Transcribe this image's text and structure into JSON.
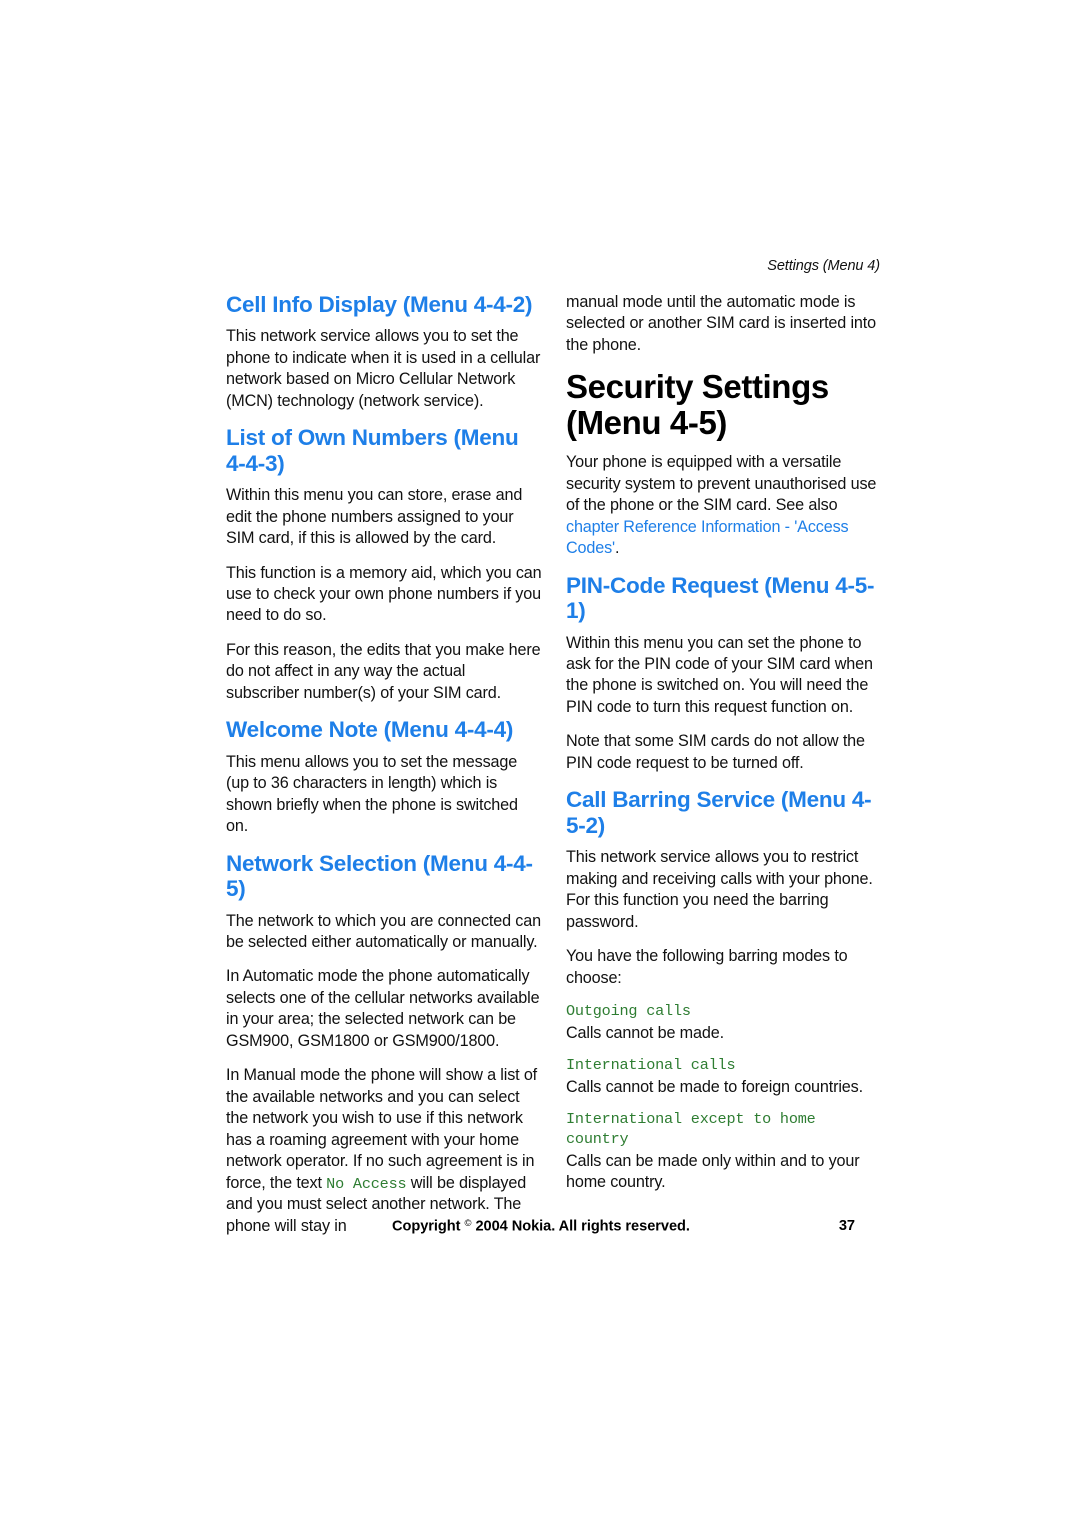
{
  "document": {
    "running_header": "Settings (Menu 4)",
    "footer": {
      "copyright_prefix": "Copyright",
      "copyright_symbol": "©",
      "copyright_suffix": "2004 Nokia. All rights reserved.",
      "page_number": "37"
    },
    "colors": {
      "heading_blue": "#1E7FE8",
      "xref_blue": "#1E7FE8",
      "ui_term_green": "#2E7D32",
      "body_black": "#111111",
      "page_background": "#FFFFFF"
    }
  },
  "left_column": {
    "cell_info_display": {
      "heading": "Cell Info Display (Menu 4-4-2)",
      "paragraph_1": "This network service allows you to set the phone to indicate when it is used in a cellular network based on Micro Cellular Network (MCN) technology (network service)."
    },
    "list_of_own_numbers": {
      "heading": "List of Own Numbers (Menu 4-4-3)",
      "paragraph_1": "Within this menu you can store, erase and edit the phone numbers assigned to your SIM card, if this is allowed by the card.",
      "paragraph_2": "This function is a memory aid, which you can use to check your own phone numbers if you need to do so.",
      "paragraph_3": "For this reason, the edits that you make here do not affect in any way the actual subscriber number(s) of your SIM card."
    },
    "welcome_note": {
      "heading": "Welcome Note (Menu 4-4-4)",
      "paragraph_1": "This menu allows you to set the message (up to 36 characters in length) which is shown briefly when the phone is switched on."
    },
    "network_selection": {
      "heading": "Network Selection (Menu 4-4-5)",
      "paragraph_1": "The network to which you are connected can be selected either automatically or manually.",
      "paragraph_2": "In Automatic mode the phone automatically selects one of the cellular networks available in your area; the selected network can be GSM900, GSM1800 or GSM900/1800.",
      "paragraph_3_part_1": "In Manual mode the phone will show a list of the available networks and you can select the network you wish to use if this network has a roaming agreement with your home network operator. If no such agreement is in force, the text ",
      "paragraph_3_ui_term": "No Access",
      "paragraph_3_part_2": " will be displayed and you must select another network. The phone will stay in"
    }
  },
  "right_column": {
    "continuation": {
      "paragraph_1": "manual mode until the automatic mode is selected or another SIM card is inserted into the phone."
    },
    "security_settings": {
      "heading": "Security Settings (Menu 4-5)",
      "paragraph_1_part_1": "Your phone is equipped with a versatile security system to prevent unauthorised use of the phone or the SIM card. See also ",
      "paragraph_1_xref": "chapter Reference Information - 'Access Codes'",
      "paragraph_1_part_2": "."
    },
    "pin_code_request": {
      "heading": "PIN-Code Request (Menu 4-5-1)",
      "paragraph_1": "Within this menu you can set the phone to ask for the PIN code of your SIM card when the phone is switched on. You will need the PIN code to turn this request function on.",
      "paragraph_2": "Note that some SIM cards do not allow the PIN code request to be turned off."
    },
    "call_barring_service": {
      "heading": "Call Barring Service (Menu 4-5-2)",
      "paragraph_1": "This network service allows you to restrict making and receiving calls with your phone. For this function you need the barring password.",
      "paragraph_2": "You have the following barring modes to choose:",
      "barring_modes": [
        {
          "term": "Outgoing calls",
          "description": "Calls cannot be made."
        },
        {
          "term": "International calls",
          "description": "Calls cannot be made to foreign countries."
        },
        {
          "term": "International except to home country",
          "description": "Calls can be made only within and to your home country."
        }
      ]
    }
  }
}
